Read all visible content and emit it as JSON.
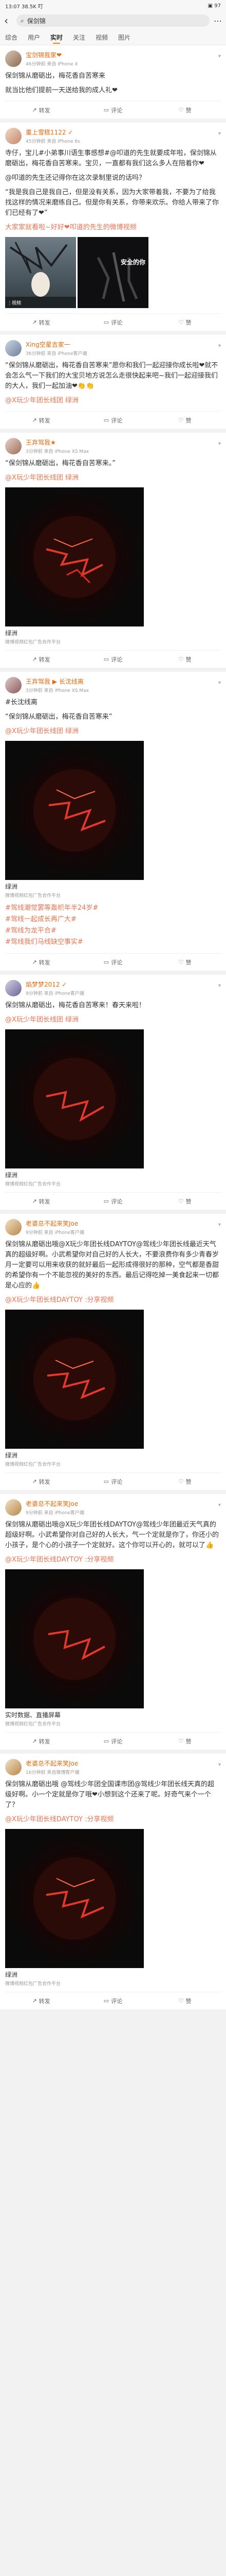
{
  "status": {
    "time": "13:07",
    "left": "13:07 38.5K 叮",
    "right": "▣ 97"
  },
  "search": {
    "query": "保剑锦"
  },
  "tabs": [
    "综合",
    "用户",
    "实时",
    "关注",
    "视频",
    "图片"
  ],
  "posts": [
    {
      "name": "宝剑锦我家❤",
      "meta": "46分钟前 来自 iPhone X",
      "lines": [
        "保剑锦从磨砺出，梅花香自苦寒来",
        "",
        "就当比他们提前一天送给我的成人礼❤"
      ],
      "actions": {
        "share": "转发",
        "comment": "评论",
        "like": "赞"
      }
    },
    {
      "name": "重上雪糕1122 ✓",
      "meta": "45分钟前 来自 iPhone 6s",
      "lines": [
        "寺仔，宝儿#小弟事川语生事感想#@叩道的先生就要成年啦，保剑锦从磨砺出，梅花香自苦寒来。宝贝，一直都有我们这么多人在陪着你❤",
        "",
        "@叩道的先生还记得你在这次录制里说的话吗？",
        "“我是我自己是我自己，但是没有关系，因为大家带着我，不要为了给我找这样的情况来磨练自己。但是你有关系，你带来欢乐。你给人带来了你们已经有了❤”",
        "大家家就看啦~好好❤叩道的先生的微博视频"
      ],
      "pic_labels": [
        "⋮视频",
        "安全的你"
      ],
      "actions": {
        "share": "转发",
        "comment": "评论",
        "like": "赞"
      }
    },
    {
      "name": "Xing空星吉家一",
      "meta": "36分钟前 来自 iPhone客户端",
      "lines": [
        "“保剑锦从磨砺出，梅花香自苦寒来”愿你和我们一起迎接你成长啦❤就不会怎么气一下我们的大宝贝地方说怎么走很快起来吧~我们一起迎接我们的大人，我们一起加油❤👏👏",
        "@X玩少年团长线团 绿洲"
      ],
      "actions": {
        "share": "转发",
        "comment": "评论",
        "like": "赞"
      }
    },
    {
      "name": "王弃驾我★",
      "meta": "3分钟前 来自 iPhone XS Max",
      "lines": [
        "“保剑锦从磨砺出，梅花香自苦寒来。”",
        "@X玩少年团长线团 绿洲"
      ],
      "video_name": "绿洲",
      "video_src": "微博视频红包广告合作平台",
      "actions": {
        "share": "转发",
        "comment": "评论",
        "like": "赞"
      }
    },
    {
      "name": "王弃驾我 ▶ 长沈线离",
      "meta": "3分钟前 来自 iPhone XS Max",
      "lines": [
        "#长沈线离",
        "“保剑锦从磨砺出，梅花香自苦寒来”",
        "@X玩少年团长线团 绿洲"
      ],
      "video_name": "绿洲",
      "video_src": "微博视频红包广告合作平台",
      "tags": [
        "#驾线潮觉罢等轰帜年半24岁#",
        "#驾线一起成长再广大#",
        "#驾线为龙平合#",
        "#驾线我们马线缺空事实#"
      ],
      "actions": {
        "share": "转发",
        "comment": "评论",
        "like": "赞"
      }
    },
    {
      "name": "焰梦梦2012 ✓",
      "meta": "9分钟前 来自 iPhone客户端",
      "lines": [
        "保剑锦从磨砺出，梅花香自苦寒来！春天来啦！",
        "@X玩少年团长线团 绿洲"
      ],
      "video_name": "绿洲",
      "video_src": "微博视频红包广告合作平台",
      "actions": {
        "share": "转发",
        "comment": "评论",
        "like": "赞"
      }
    },
    {
      "name": "老婆总不起来笑Joe",
      "meta": "9分钟前 来自 iPhone客户端",
      "lines": [
        "保剑锦从磨砺出哦@X玩少年团长线DAYTOY@驾线少年团长线最近天气真的超级好啊。小武希望你对自己好的人长大，不要浪费你有多少青春岁月一定要可以用来收获的就好最后一起形成得很好的那种，空气都是香甜的希望你有一个不能忽视的美好的东西。最后记得吃掉一美食起来一切都是心应的👍",
        "@X玩少年团长线DAYTOY :分享视频"
      ],
      "video_name": "绿洲",
      "video_src": "微博视频红包广告合作平台",
      "actions": {
        "share": "转发",
        "comment": "评论",
        "like": "赞"
      }
    },
    {
      "name": "老婆总不起来笑Joe",
      "meta": "9分钟前 来自 iPhone客户端",
      "lines": [
        "保剑锦从磨砺出哦@X玩少年团长线DAYTOY@驾线少年团最近天气真的超级好啊。小武希望你对自己好的人长大，气一个定就是你了，你还小的小孩子，是个心的小孩子一个定就好。这个你可以开心的，就可以了👍",
        "@X玩少年团长线DAYTOY :分享视频"
      ],
      "video_name": "实时数据、直播屏幕",
      "video_src": "微博视频红包广告合作平台",
      "actions": {
        "share": "转发",
        "comment": "评论",
        "like": "赞"
      }
    },
    {
      "name": "老婆总不起来笑Joe",
      "meta": "16分钟前 来自微博客户端",
      "lines": [
        "保剑锦从磨砺出哦 @驾线少年团全国课市团@驾线少年团长线天真的超级好啊。小一个定就是你了哦❤小想到这个还来了呢。好奇气来个一个了？",
        "@X玩少年团长线DAYTOY :分享视频"
      ],
      "video_name": "绿洲",
      "video_src": "微博视频红包广告合作平台",
      "actions": {
        "share": "转发",
        "comment": "评论",
        "like": "赞"
      }
    }
  ]
}
